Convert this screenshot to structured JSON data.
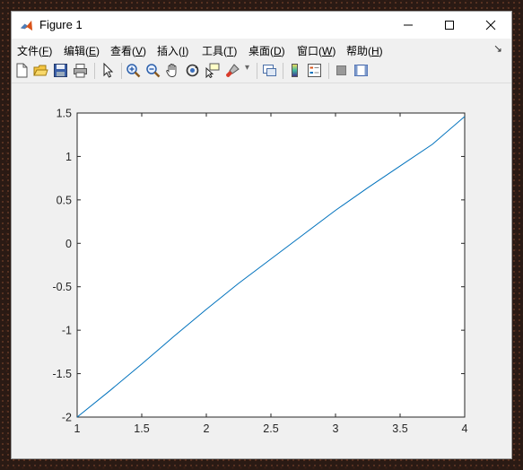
{
  "window": {
    "title": "Figure 1"
  },
  "menu": {
    "items": [
      {
        "label": "文件(",
        "key": "F",
        "end": ")"
      },
      {
        "label": "编辑(",
        "key": "E",
        "end": ")"
      },
      {
        "label": "查看(",
        "key": "V",
        "end": ")"
      },
      {
        "label": "插入(",
        "key": "I",
        "end": ")"
      },
      {
        "label": "工具(",
        "key": "T",
        "end": ")"
      },
      {
        "label": "桌面(",
        "key": "D",
        "end": ")"
      },
      {
        "label": "窗口(",
        "key": "W",
        "end": ")"
      },
      {
        "label": "帮助(",
        "key": "H",
        "end": ")"
      }
    ],
    "overflow_arrow": "↘"
  },
  "toolbar": {
    "buttons": [
      "new-figure-icon",
      "open-file-icon",
      "save-icon",
      "print-icon",
      "pointer-icon",
      "zoom-in-icon",
      "zoom-out-icon",
      "pan-hand-icon",
      "rotate-3d-icon",
      "data-cursor-icon",
      "brush-icon",
      "link-plot-icon",
      "colorbar-icon",
      "legend-icon",
      "hide-plot-tools-icon",
      "show-plot-tools-icon"
    ]
  },
  "chart_data": {
    "type": "line",
    "title": "",
    "xlabel": "",
    "ylabel": "",
    "xlim": [
      1,
      4
    ],
    "ylim": [
      -2,
      1.5
    ],
    "xticks": [
      "1",
      "1.5",
      "2",
      "2.5",
      "3",
      "3.5",
      "4"
    ],
    "yticks": [
      "1.5",
      "1",
      "0.5",
      "0",
      "-0.5",
      "-1",
      "-1.5",
      "-2"
    ],
    "grid": false,
    "series": [
      {
        "color": "#0072bd",
        "x": [
          1,
          1.25,
          1.5,
          1.75,
          2,
          2.25,
          2.5,
          2.75,
          3,
          3.25,
          3.5,
          3.75,
          4
        ],
        "y": [
          -2,
          -1.7,
          -1.39,
          -1.07,
          -0.76,
          -0.46,
          -0.18,
          0.1,
          0.38,
          0.64,
          0.89,
          1.14,
          1.46
        ]
      }
    ]
  }
}
